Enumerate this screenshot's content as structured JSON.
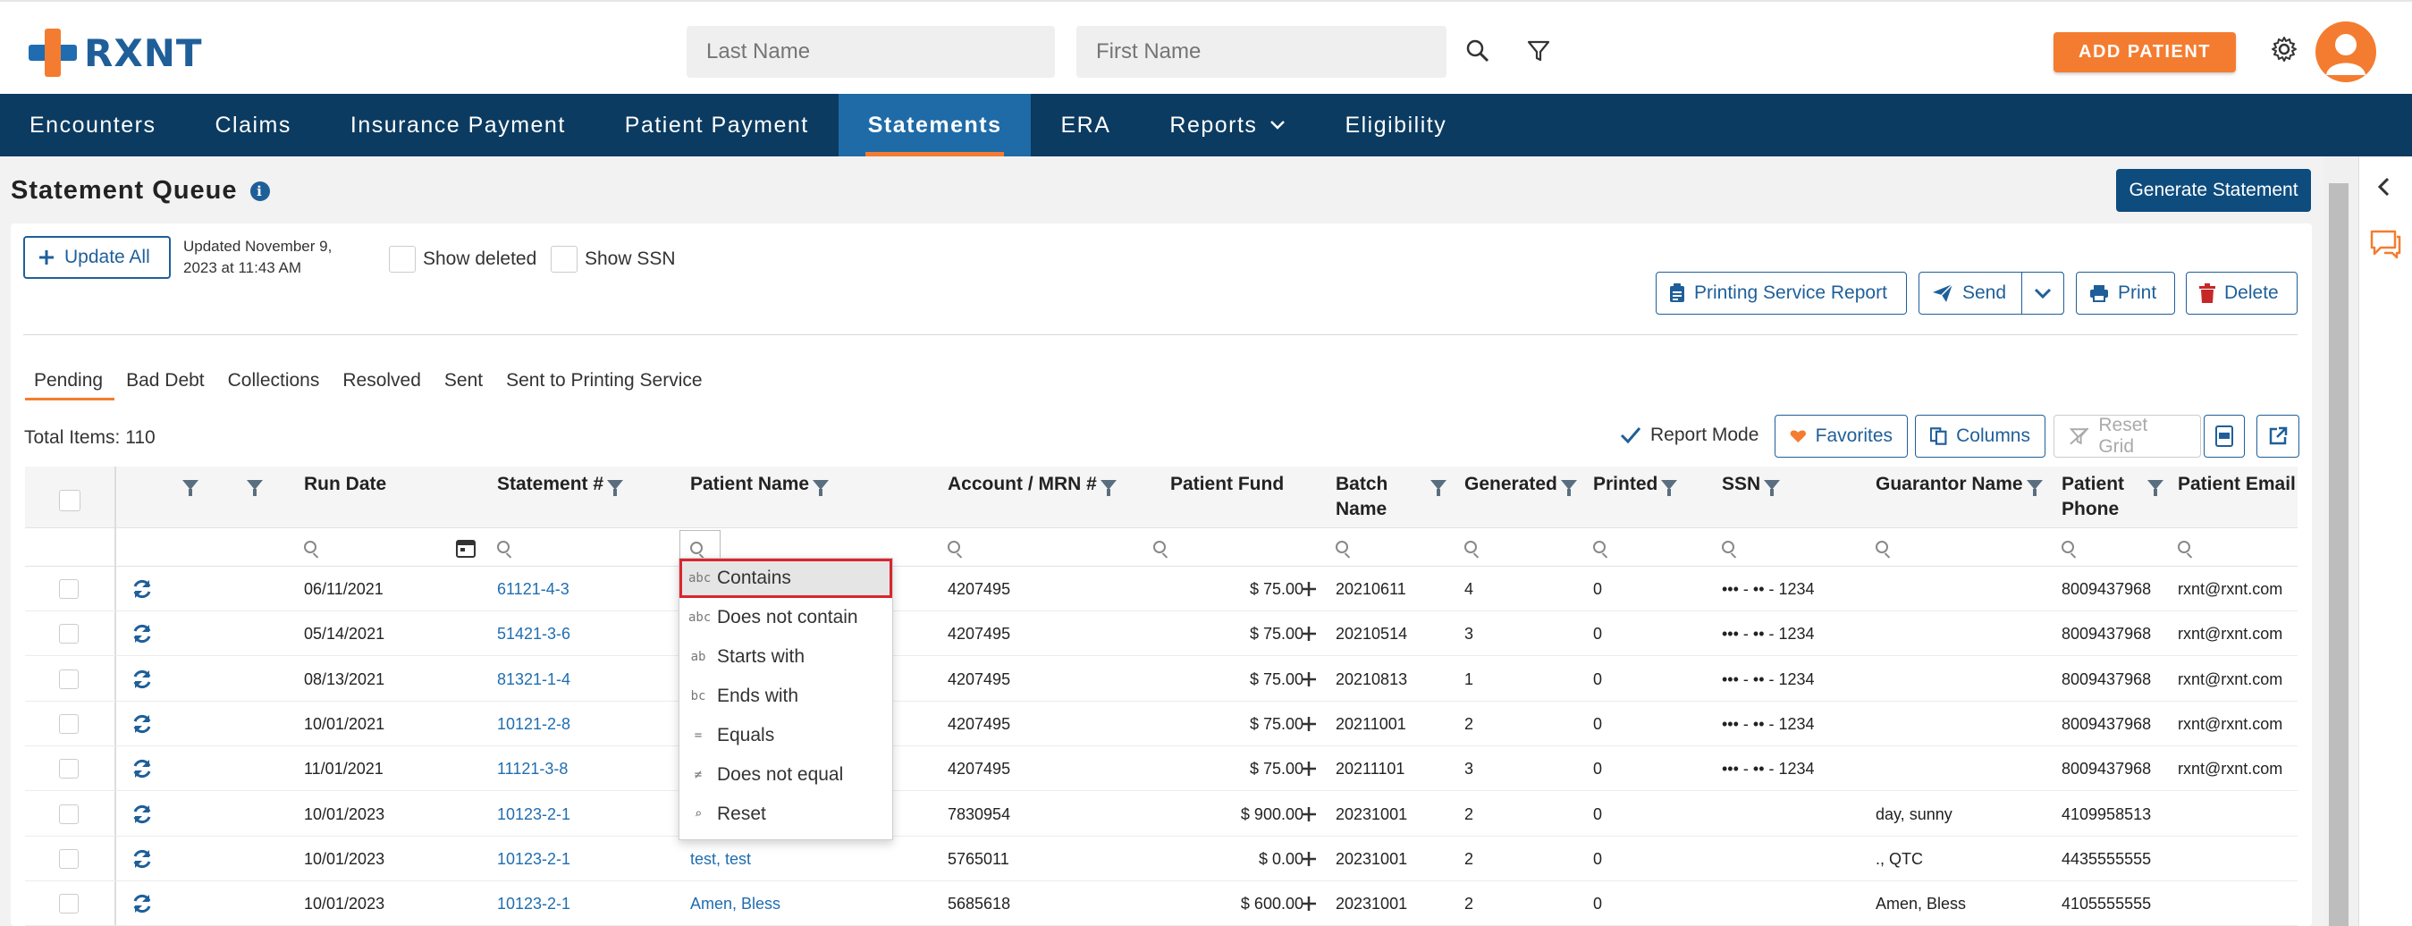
{
  "brand": {
    "name": "RXNT"
  },
  "header": {
    "last_name_placeholder": "Last Name",
    "first_name_placeholder": "First Name",
    "add_patient_label": "ADD PATIENT"
  },
  "nav": {
    "items": [
      {
        "label": "Encounters"
      },
      {
        "label": "Claims"
      },
      {
        "label": "Insurance Payment"
      },
      {
        "label": "Patient Payment"
      },
      {
        "label": "Statements"
      },
      {
        "label": "ERA"
      },
      {
        "label": "Reports"
      },
      {
        "label": "Eligibility"
      }
    ],
    "active": "Statements"
  },
  "page": {
    "title": "Statement Queue",
    "generate_label": "Generate Statement",
    "update_all_label": "Update All",
    "updated_text": "Updated November 9, 2023 at 11:43 AM",
    "show_deleted_label": "Show deleted",
    "show_ssn_label": "Show SSN"
  },
  "actions": {
    "printing_report_label": "Printing Service Report",
    "send_label": "Send",
    "print_label": "Print",
    "delete_label": "Delete"
  },
  "tabs": [
    {
      "label": "Pending"
    },
    {
      "label": "Bad Debt"
    },
    {
      "label": "Collections"
    },
    {
      "label": "Resolved"
    },
    {
      "label": "Sent"
    },
    {
      "label": "Sent to Printing Service"
    }
  ],
  "grid_toolbar": {
    "total_items": "Total Items: 110",
    "report_mode_label": "Report Mode",
    "favorites_label": "Favorites",
    "columns_label": "Columns",
    "reset_grid_label": "Reset Grid"
  },
  "columns": {
    "run_date": "Run Date",
    "statement_no": "Statement #",
    "patient_name": "Patient Name",
    "account_mrn": "Account / MRN #",
    "patient_fund": "Patient Fund",
    "batch_name_1": "Batch",
    "batch_name_2": "Name",
    "generated": "Generated",
    "printed": "Printed",
    "ssn": "SSN",
    "guarantor_name": "Guarantor Name",
    "patient_phone_1": "Patient",
    "patient_phone_2": "Phone",
    "patient_email": "Patient Email"
  },
  "rows": [
    {
      "run_date": "06/11/2021",
      "statement": "61121-4-3",
      "patient": "",
      "account": "4207495",
      "fund": "$ 75.00",
      "batch": "20210611",
      "generated": "4",
      "printed": "0",
      "ssn": "••• - •• - 1234",
      "guarantor": "",
      "phone": "8009437968",
      "email": "rxnt@rxnt.com"
    },
    {
      "run_date": "05/14/2021",
      "statement": "51421-3-6",
      "patient": "",
      "account": "4207495",
      "fund": "$ 75.00",
      "batch": "20210514",
      "generated": "3",
      "printed": "0",
      "ssn": "••• - •• - 1234",
      "guarantor": "",
      "phone": "8009437968",
      "email": "rxnt@rxnt.com"
    },
    {
      "run_date": "08/13/2021",
      "statement": "81321-1-4",
      "patient": "",
      "account": "4207495",
      "fund": "$ 75.00",
      "batch": "20210813",
      "generated": "1",
      "printed": "0",
      "ssn": "••• - •• - 1234",
      "guarantor": "",
      "phone": "8009437968",
      "email": "rxnt@rxnt.com"
    },
    {
      "run_date": "10/01/2021",
      "statement": "10121-2-8",
      "patient": "",
      "account": "4207495",
      "fund": "$ 75.00",
      "batch": "20211001",
      "generated": "2",
      "printed": "0",
      "ssn": "••• - •• - 1234",
      "guarantor": "",
      "phone": "8009437968",
      "email": "rxnt@rxnt.com"
    },
    {
      "run_date": "11/01/2021",
      "statement": "11121-3-8",
      "patient": "",
      "account": "4207495",
      "fund": "$ 75.00",
      "batch": "20211101",
      "generated": "3",
      "printed": "0",
      "ssn": "••• - •• - 1234",
      "guarantor": "",
      "phone": "8009437968",
      "email": "rxnt@rxnt.com"
    },
    {
      "run_date": "10/01/2023",
      "statement": "10123-2-1",
      "patient": "",
      "account": "7830954",
      "fund": "$ 900.00",
      "batch": "20231001",
      "generated": "2",
      "printed": "0",
      "ssn": "",
      "guarantor": "day, sunny",
      "phone": "4109958513",
      "email": ""
    },
    {
      "run_date": "10/01/2023",
      "statement": "10123-2-1",
      "patient": "test, test",
      "account": "5765011",
      "fund": "$ 0.00",
      "batch": "20231001",
      "generated": "2",
      "printed": "0",
      "ssn": "",
      "guarantor": "., QTC",
      "phone": "4435555555",
      "email": ""
    },
    {
      "run_date": "10/01/2023",
      "statement": "10123-2-1",
      "patient": "Amen, Bless",
      "account": "5685618",
      "fund": "$ 600.00",
      "batch": "20231001",
      "generated": "2",
      "printed": "0",
      "ssn": "",
      "guarantor": "Amen, Bless",
      "phone": "4105555555",
      "email": ""
    }
  ],
  "filter_menu": {
    "items": [
      {
        "label": "Contains",
        "glyph": "abc"
      },
      {
        "label": "Does not contain",
        "glyph": "abc"
      },
      {
        "label": "Starts with",
        "glyph": "ab"
      },
      {
        "label": "Ends with",
        "glyph": "bc"
      },
      {
        "label": "Equals",
        "glyph": "="
      },
      {
        "label": "Does not equal",
        "glyph": "≠"
      },
      {
        "label": "Reset",
        "glyph": "⌕"
      }
    ],
    "selected": "Contains"
  },
  "colors": {
    "brand_orange": "#f47c30",
    "nav_dark": "#0b3b61",
    "nav_active": "#1e6ba8",
    "link_blue": "#1f6db0"
  }
}
